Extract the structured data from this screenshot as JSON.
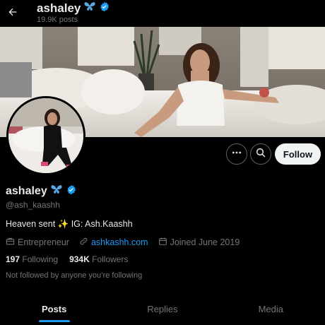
{
  "header": {
    "name": "ashaley",
    "posts": "19.9K posts"
  },
  "profile": {
    "display_name": "ashaley",
    "handle": "@ash_kaashh",
    "bio": "Heaven sent ✨ IG: Ash.Kaashh",
    "category": "Entrepreneur",
    "website": "ashkashh.com",
    "joined": "Joined June 2019",
    "following_count": "197",
    "following_label": "Following",
    "followers_count": "934K",
    "followers_label": "Followers",
    "not_followed": "Not followed by anyone you’re following",
    "name_emoji": "butterfly-icon",
    "verified_color": "#1d9bf0"
  },
  "actions": {
    "more_icon": "more-icon",
    "search_icon": "search-icon",
    "follow_label": "Follow"
  },
  "tabs": [
    {
      "label": "Posts",
      "active": true
    },
    {
      "label": "Replies",
      "active": false
    },
    {
      "label": "Media",
      "active": false
    }
  ],
  "colors": {
    "accent": "#1d9bf0",
    "background": "#000000",
    "muted": "#71767b"
  }
}
